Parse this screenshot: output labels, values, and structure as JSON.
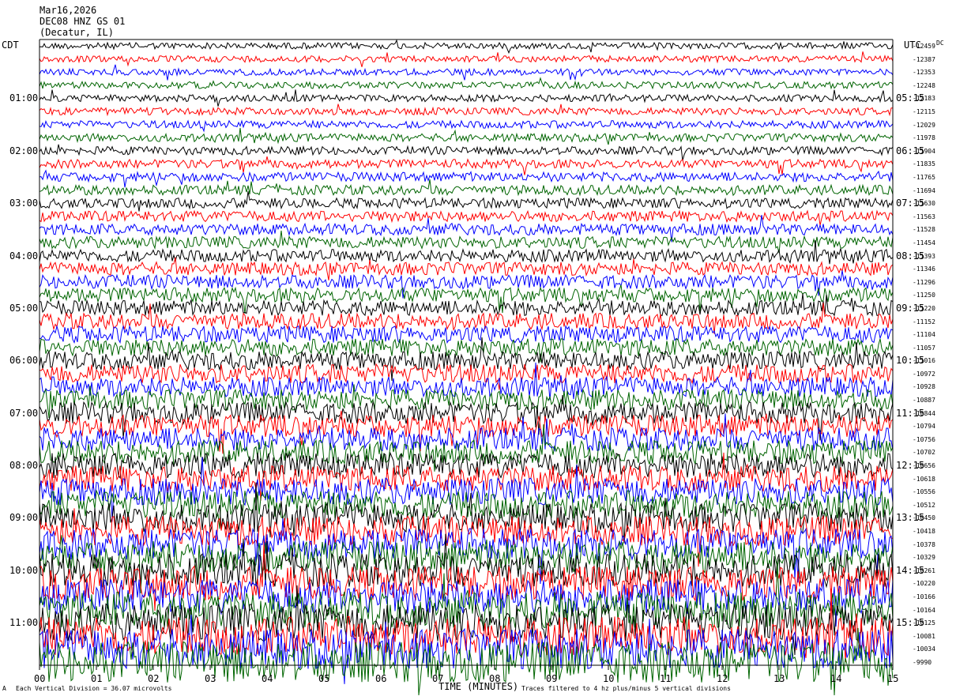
{
  "header": {
    "date": "Mar16,2026",
    "station": "DEC08 HNZ GS 01",
    "location": "(Decatur, IL)"
  },
  "axes": {
    "left_tz": "CDT",
    "right_tz": "UTC",
    "dc_label": "DC"
  },
  "footer": {
    "bottom_marker": "A",
    "left_note": "Each Vertical Division = 36.07 microvolts",
    "center_note": "TIME (MINUTES)",
    "right_note": "Traces filtered to 4 hz plus/minus 5 vertical divisions"
  },
  "colors": {
    "black": "#000000",
    "red": "#ff0000",
    "blue": "#0000ff",
    "green": "#006400",
    "frame": "#000000"
  },
  "chart_data": {
    "type": "line",
    "subtype": "helicorder",
    "x": {
      "label": "TIME (MINUTES)",
      "range": [
        0,
        15
      ],
      "ticks": [
        "00",
        "01",
        "02",
        "03",
        "04",
        "05",
        "06",
        "07",
        "08",
        "09",
        "10",
        "11",
        "12",
        "13",
        "14",
        "15"
      ]
    },
    "trace_colors_cycle": [
      "black",
      "red",
      "blue",
      "green"
    ],
    "trace_count": 48,
    "left_ticks": [
      "01:00",
      "02:00",
      "03:00",
      "04:00",
      "05:00",
      "06:00",
      "07:00",
      "08:00",
      "09:00",
      "10:00",
      "11:00"
    ],
    "right_ticks": [
      "05:15",
      "06:15",
      "07:15",
      "08:15",
      "09:15",
      "10:15",
      "11:15",
      "12:15",
      "13:15",
      "14:15",
      "15:15"
    ],
    "dc_offsets": [
      "-12459",
      "-12387",
      "-12353",
      "-12248",
      "-12183",
      "-12115",
      "-12029",
      "-11978",
      "-11904",
      "-11835",
      "-11765",
      "-11694",
      "-11630",
      "-11563",
      "-11528",
      "-11454",
      "-11393",
      "-11346",
      "-11296",
      "-11250",
      "-11220",
      "-11152",
      "-11104",
      "-11057",
      "-11016",
      "-10972",
      "-10928",
      "-10887",
      "-10844",
      "-10794",
      "-10756",
      "-10702",
      "-10656",
      "-10618",
      "-10556",
      "-10512",
      "-10450",
      "-10418",
      "-10378",
      "-10329",
      "-10261",
      "-10220",
      "-10166",
      "-10164",
      "-10125",
      "-10081",
      "-10034",
      "-9990"
    ]
  }
}
